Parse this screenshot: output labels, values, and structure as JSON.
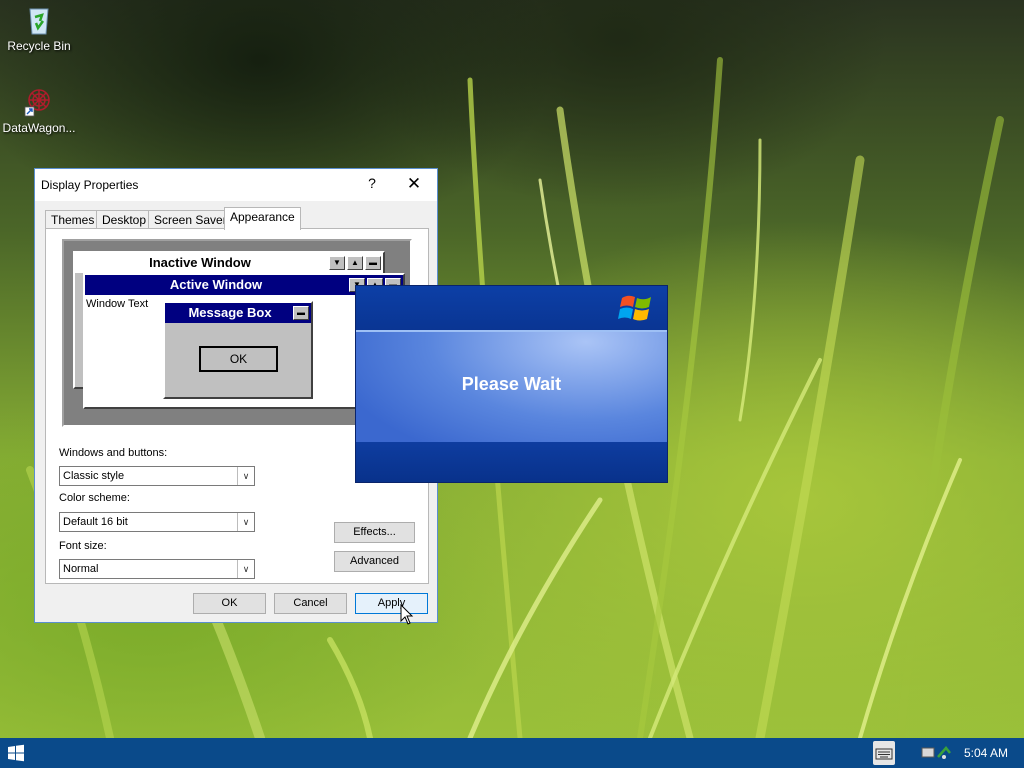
{
  "desktop": {
    "icons": [
      {
        "label": "Recycle Bin",
        "icon": "recycle-bin-icon"
      },
      {
        "label": "DataWagon...",
        "icon": "datawagon-app-icon"
      }
    ]
  },
  "display_properties": {
    "title": "Display Properties",
    "help_label": "?",
    "close_label": "✕",
    "tabs": [
      "Themes",
      "Desktop",
      "Screen Saver",
      "Appearance"
    ],
    "active_tab": "Appearance",
    "preview": {
      "inactive_title": "Inactive Window",
      "active_title": "Active Window",
      "window_text": "Window Text",
      "message_box_title": "Message Box",
      "ok_label": "OK"
    },
    "windows_and_buttons": {
      "label": "Windows and buttons:",
      "value": "Classic style"
    },
    "color_scheme": {
      "label": "Color scheme:",
      "value": "Default 16 bit"
    },
    "font_size": {
      "label": "Font size:",
      "value": "Normal"
    },
    "effects_label": "Effects...",
    "advanced_label": "Advanced",
    "ok_label": "OK",
    "cancel_label": "Cancel",
    "apply_label": "Apply"
  },
  "please_wait": {
    "message": "Please Wait",
    "logo": "windows-flag-icon"
  },
  "taskbar": {
    "clock": "5:04 AM",
    "start_icon": "windows-start-icon",
    "tray_icons": [
      "keyboard-icon",
      "network-icon"
    ]
  },
  "colors": {
    "active_title": "#000080",
    "inactive_title": "#ffffff",
    "taskbar": "#0a4a8a",
    "please_wait_blue": "#0b3d9e"
  }
}
